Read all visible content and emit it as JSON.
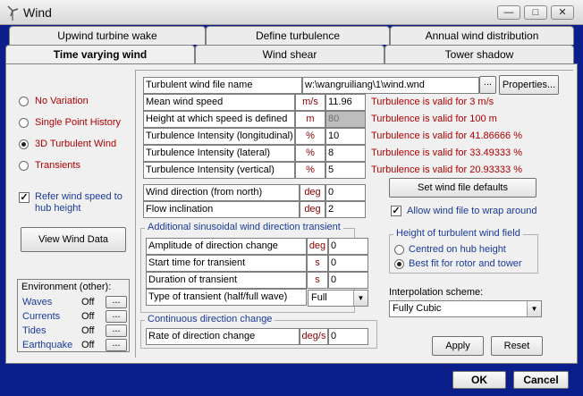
{
  "window": {
    "title": "Wind"
  },
  "tabs": {
    "row_back": [
      "Upwind turbine wake",
      "Define turbulence",
      "Annual wind distribution"
    ],
    "row_front": [
      "Time varying wind",
      "Wind shear",
      "Tower shadow"
    ]
  },
  "variation": {
    "options": [
      "No Variation",
      "Single Point History",
      "3D Turbulent Wind",
      "Transients"
    ],
    "selected": "3D Turbulent Wind"
  },
  "refer_wind_speed": {
    "label": "Refer wind speed to hub height",
    "checked": true
  },
  "view_wind_data_label": "View Wind Data",
  "environment": {
    "title": "Environment (other):",
    "items": [
      {
        "name": "Waves",
        "value": "Off"
      },
      {
        "name": "Currents",
        "value": "Off"
      },
      {
        "name": "Tides",
        "value": "Off"
      },
      {
        "name": "Earthquake",
        "value": "Off"
      }
    ],
    "edit_label": "..."
  },
  "turbulent": {
    "file_label": "Turbulent wind file name",
    "file_value": "w:\\wangruiliang\\1\\wind.wnd",
    "browse_label": "...",
    "properties_label": "Properties...",
    "rows": [
      {
        "label": "Mean wind speed",
        "unit": "m/s",
        "value": "11.96",
        "valid": "Turbulence is valid for  3 m/s"
      },
      {
        "label": "Height at which speed is defined",
        "unit": "m",
        "value": "80",
        "valid": "Turbulence is valid for  100 m"
      },
      {
        "label": "Turbulence Intensity (longitudinal)",
        "unit": "%",
        "value": "10",
        "valid": "Turbulence is valid for  41.86666 %"
      },
      {
        "label": "Turbulence Intensity (lateral)",
        "unit": "%",
        "value": "8",
        "valid": "Turbulence is valid for  33.49333 %"
      },
      {
        "label": "Turbulence Intensity (vertical)",
        "unit": "%",
        "value": "5",
        "valid": "Turbulence is valid for  20.93333 %"
      }
    ]
  },
  "direction": {
    "rows": [
      {
        "label": "Wind direction (from north)",
        "unit": "deg",
        "value": "0"
      },
      {
        "label": "Flow inclination",
        "unit": "deg",
        "value": "2"
      }
    ]
  },
  "set_defaults_label": "Set wind file defaults",
  "wrap_around": {
    "label": "Allow wind file to wrap around",
    "checked": true
  },
  "transient": {
    "title": "Additional sinusoidal wind direction transient",
    "rows": [
      {
        "label": "Amplitude of direction change",
        "unit": "deg",
        "value": "0"
      },
      {
        "label": "Start time for transient",
        "unit": "s",
        "value": "0"
      },
      {
        "label": "Duration of transient",
        "unit": "s",
        "value": "0"
      }
    ],
    "type_label": "Type of transient (half/full wave)",
    "type_value": "Full"
  },
  "continuous": {
    "title": "Continuous direction change",
    "label": "Rate of direction change",
    "unit": "deg/s",
    "value": "0"
  },
  "height_field": {
    "title": "Height of turbulent wind field",
    "options": [
      "Centred on hub height",
      "Best fit for rotor and tower"
    ],
    "selected": "Best fit for rotor and tower"
  },
  "interpolation": {
    "label": "Interpolation scheme:",
    "value": "Fully Cubic"
  },
  "apply_label": "Apply",
  "reset_label": "Reset",
  "ok_label": "OK",
  "cancel_label": "Cancel",
  "colors": {
    "frame": "#0b1f8a",
    "unit_red": "#8b0000",
    "valid_red": "#b00000",
    "label_blue": "#1a3a9a"
  }
}
